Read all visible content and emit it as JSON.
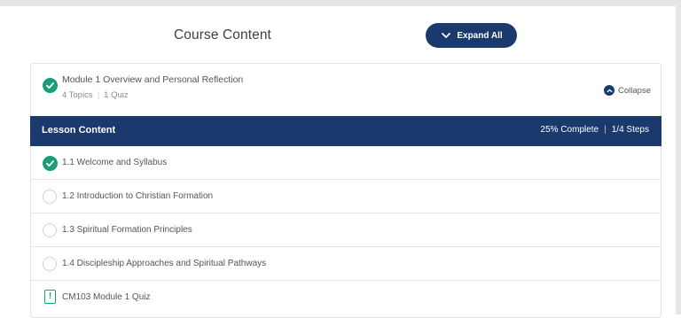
{
  "header": {
    "title": "Course Content",
    "expand_label": "Expand All"
  },
  "module": {
    "title": "Module 1 Overview and Personal Reflection",
    "topics": "4 Topics",
    "quizzes": "1 Quiz",
    "collapse_label": "Collapse",
    "completed": true
  },
  "lesson_bar": {
    "label": "Lesson Content",
    "percent": "25% Complete",
    "steps": "1/4 Steps"
  },
  "items": [
    {
      "label": "1.1 Welcome and Syllabus",
      "status": "complete"
    },
    {
      "label": "1.2 Introduction to Christian Formation",
      "status": "incomplete"
    },
    {
      "label": "1.3 Spiritual Formation Principles",
      "status": "incomplete"
    },
    {
      "label": "1.4 Discipleship Approaches and Spiritual Pathways",
      "status": "incomplete"
    },
    {
      "label": "CM103 Module 1 Quiz",
      "status": "quiz"
    }
  ],
  "colors": {
    "navy": "#1a3a6e",
    "green": "#1a9e78"
  }
}
